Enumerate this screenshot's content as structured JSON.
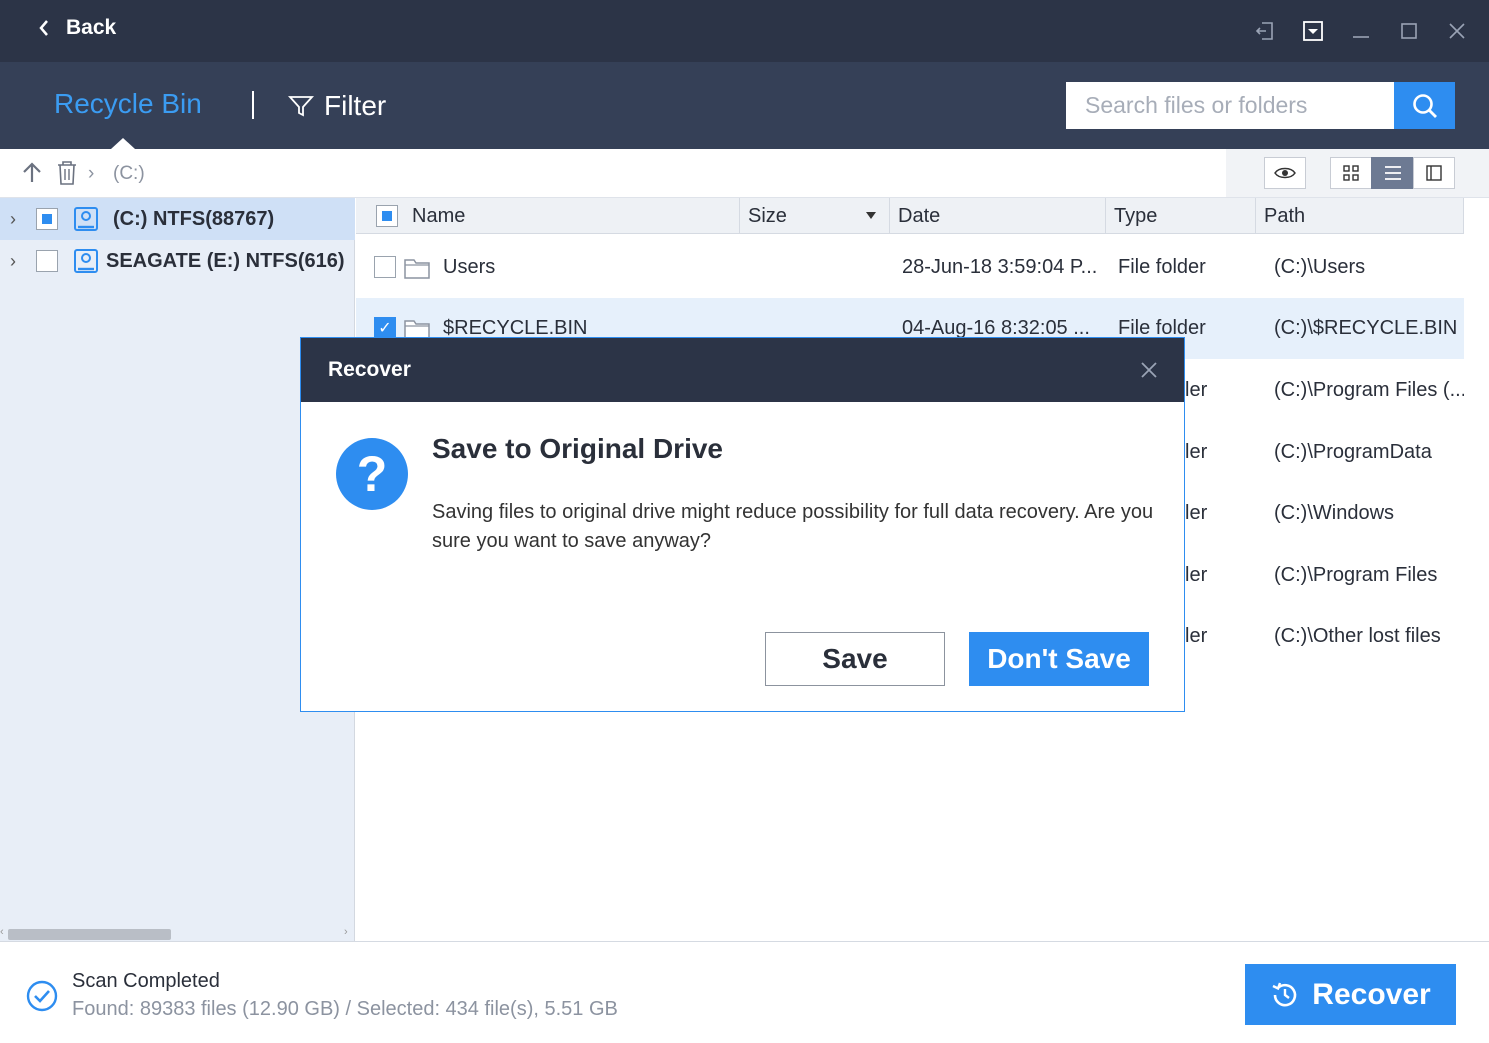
{
  "titlebar": {
    "back_label": "Back",
    "controls": [
      "signout-icon",
      "dropdown-icon",
      "minimize-icon",
      "maximize-icon",
      "close-icon"
    ]
  },
  "header": {
    "tab_label": "Recycle Bin",
    "filter_label": "Filter",
    "search_placeholder": "Search files or folders"
  },
  "toolbar": {
    "breadcrumb": "(C:)"
  },
  "sidebar": {
    "items": [
      {
        "label": "(C:) NTFS(88767)",
        "state": "partial",
        "selected": true
      },
      {
        "label": "SEAGATE (E:) NTFS(616)",
        "state": "unchecked",
        "selected": false
      }
    ]
  },
  "table": {
    "columns": {
      "name": "Name",
      "size": "Size",
      "date": "Date",
      "type": "Type",
      "path": "Path"
    },
    "rows": [
      {
        "name": "Users",
        "size": "",
        "date": "28-Jun-18 3:59:04 P...",
        "type": "File folder",
        "path": "(C:)\\Users",
        "checked": false
      },
      {
        "name": "$RECYCLE.BIN",
        "size": "",
        "date": "04-Aug-16 8:32:05 ...",
        "type": "File folder",
        "path": "(C:)\\$RECYCLE.BIN",
        "checked": true
      },
      {
        "type_visible": "ler",
        "path": "(C:)\\Program Files (..."
      },
      {
        "type_visible": "ler",
        "path": "(C:)\\ProgramData"
      },
      {
        "type_visible": "ler",
        "path": "(C:)\\Windows"
      },
      {
        "type_visible": "ler",
        "path": "(C:)\\Program Files"
      },
      {
        "type_visible": "ler",
        "path": "(C:)\\Other lost files"
      }
    ]
  },
  "modal": {
    "title": "Recover",
    "heading": "Save to Original Drive",
    "message": "Saving files to original drive might reduce possibility for full data recovery. Are you sure you want to save anyway?",
    "save_label": "Save",
    "dont_save_label": "Don't Save"
  },
  "footer": {
    "status_title": "Scan Completed",
    "status_detail": "Found: 89383 files (12.90 GB) / Selected: 434 file(s), 5.51 GB",
    "recover_label": "Recover"
  },
  "colors": {
    "titlebar": "#2c3447",
    "header": "#354057",
    "accent": "#2e8df0",
    "sidebar": "#e8eef7"
  }
}
